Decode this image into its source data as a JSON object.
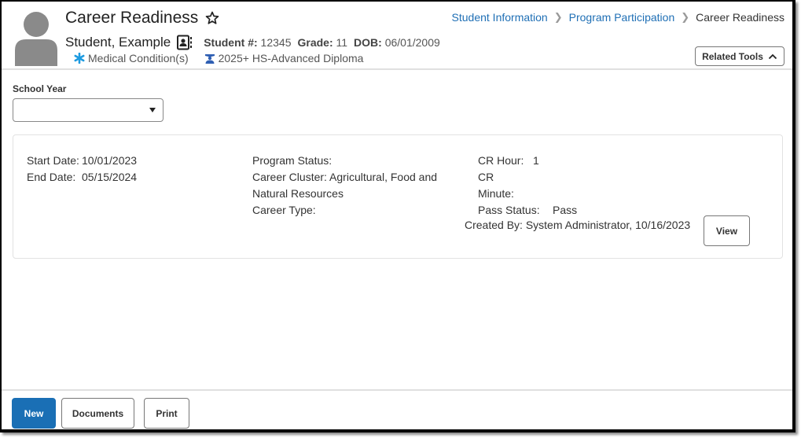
{
  "header": {
    "title": "Career Readiness",
    "student_name": "Student, Example",
    "student_number_label": "Student #:",
    "student_number": "12345",
    "grade_label": "Grade:",
    "grade": "11",
    "dob_label": "DOB:",
    "dob": "06/01/2009",
    "flags": [
      {
        "icon": "asterisk-icon",
        "label": "Medical Condition(s)",
        "color": "#1e9be0"
      },
      {
        "icon": "graduation-icon",
        "label": "2025+ HS-Advanced Diploma",
        "color": "#2f5fb3"
      }
    ],
    "related_tools_label": "Related Tools"
  },
  "breadcrumb": {
    "items": [
      "Student Information",
      "Program Participation"
    ],
    "current": "Career Readiness",
    "separator": ">"
  },
  "filters": {
    "school_year_label": "School Year",
    "school_year_value": ""
  },
  "record": {
    "start_date_label": "Start Date:",
    "start_date": "10/01/2023",
    "end_date_label": "End Date:",
    "end_date": "05/15/2024",
    "program_status_label": "Program Status:",
    "program_status": "",
    "career_cluster_label": "Career Cluster:",
    "career_cluster": "Agricultural, Food and Natural Resources",
    "career_type_label": "Career Type:",
    "career_type": "",
    "cr_hour_label": "CR Hour:",
    "cr_hour": "1",
    "cr_minute_label": "CR Minute:",
    "cr_minute": "",
    "pass_status_label": "Pass Status:",
    "pass_status": "Pass",
    "created_by": "Created By: System Administrator, 10/16/2023",
    "view_label": "View"
  },
  "footer": {
    "new_label": "New",
    "documents_label": "Documents",
    "print_label": "Print"
  },
  "colors": {
    "accent": "#1a6fb5",
    "link": "#1f6fb5"
  }
}
